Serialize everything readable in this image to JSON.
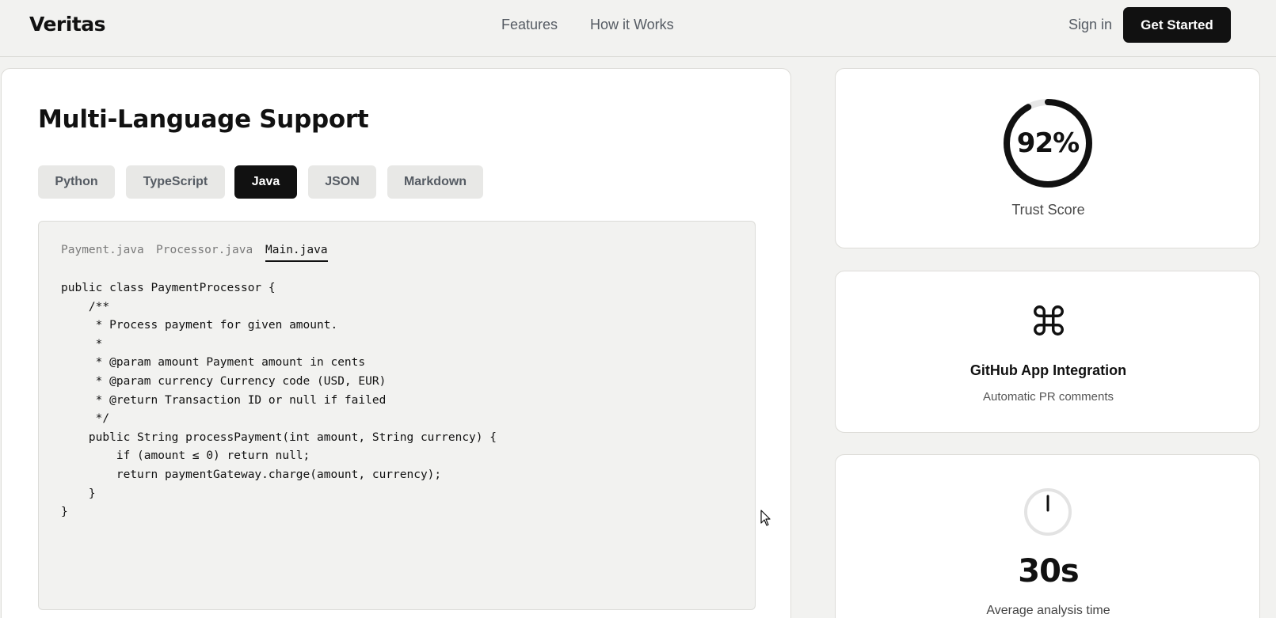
{
  "header": {
    "logo": "Veritas",
    "nav": [
      "Features",
      "How it Works"
    ],
    "signin": "Sign in",
    "cta": "Get Started"
  },
  "main": {
    "title": "Multi-Language Support",
    "language_tabs": [
      {
        "label": "Python",
        "active": false
      },
      {
        "label": "TypeScript",
        "active": false
      },
      {
        "label": "Java",
        "active": true
      },
      {
        "label": "JSON",
        "active": false
      },
      {
        "label": "Markdown",
        "active": false
      }
    ],
    "file_tabs": [
      {
        "label": "Payment.java",
        "active": false
      },
      {
        "label": "Processor.java",
        "active": false
      },
      {
        "label": "Main.java",
        "active": true
      }
    ],
    "code": "public class PaymentProcessor {\n    /**\n     * Process payment for given amount.\n     *\n     * @param amount Payment amount in cents\n     * @param currency Currency code (USD, EUR)\n     * @return Transaction ID or null if failed\n     */\n    public String processPayment(int amount, String currency) {\n        if (amount ≤ 0) return null;\n        return paymentGateway.charge(amount, currency);\n    }\n}"
  },
  "cards": {
    "trust": {
      "value": "92%",
      "percent": 92,
      "label": "Trust Score"
    },
    "github": {
      "icon": "command-icon",
      "title": "GitHub App Integration",
      "subtitle": "Automatic PR comments"
    },
    "time": {
      "icon": "clock-icon",
      "value": "30s",
      "label": "Average analysis time"
    }
  },
  "colors": {
    "background": "#f2f2f0",
    "accent": "#111111",
    "muted_tab": "#e8e8e6"
  }
}
